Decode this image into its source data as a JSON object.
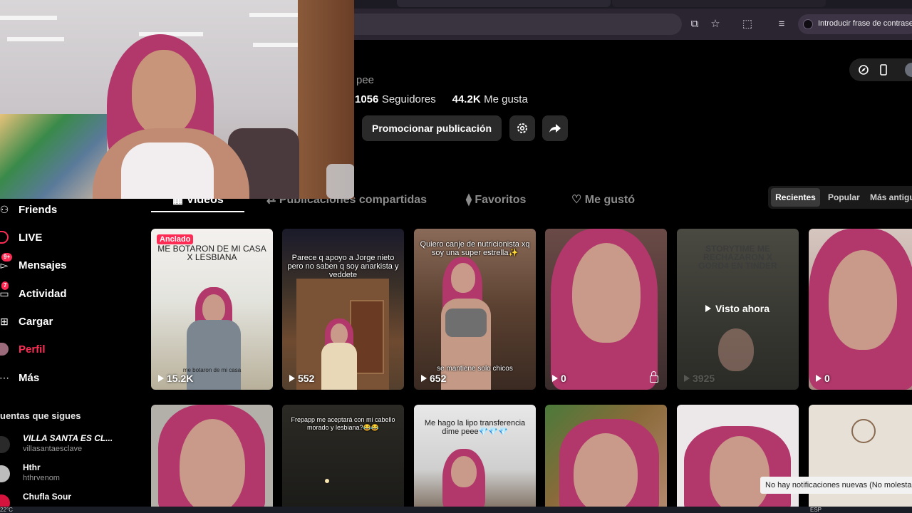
{
  "browser": {
    "extension_prompt": "Introducir frase de contrase"
  },
  "profile": {
    "username_fragment": "pee",
    "followers_count": "1056",
    "followers_label": "Seguidores",
    "likes_count": "44.2K",
    "likes_label": "Me gusta",
    "promote_button": "Promocionar publicación"
  },
  "content_tabs": [
    {
      "label": "Videos",
      "active": true
    },
    {
      "label": "Publicaciones compartidas",
      "active": false
    },
    {
      "label": "Favoritos",
      "active": false
    },
    {
      "label": "Me gustó",
      "active": false
    }
  ],
  "sort_options": [
    "Recientes",
    "Popular",
    "Más antigu"
  ],
  "sidebar": {
    "items": [
      {
        "label": "Friends",
        "icon": "friends-icon"
      },
      {
        "label": "LIVE",
        "icon": "live-icon"
      },
      {
        "label": "Mensajes",
        "icon": "messages-icon",
        "badge": "9+"
      },
      {
        "label": "Actividad",
        "icon": "activity-icon",
        "badge": "7"
      },
      {
        "label": "Cargar",
        "icon": "upload-icon"
      },
      {
        "label": "Perfil",
        "icon": "profile-avatar-icon",
        "active": true
      },
      {
        "label": "Más",
        "icon": "more-icon"
      }
    ],
    "following_heading": "uentas que sigues",
    "following": [
      {
        "name": "VILLA SANTA ES CL...",
        "handle": "villasantaesclave"
      },
      {
        "name": "Hthr",
        "handle": "hthrvenom"
      },
      {
        "name": "Chufla Sour",
        "handle": ""
      }
    ]
  },
  "videos": [
    {
      "caption": "ME BOTARON DE MI CASA X LESBIANA",
      "views": "15.2K",
      "pinned_label": "Anclado",
      "subcaption": "me botaron de mi casa"
    },
    {
      "caption": "Parece q apoyo a Jorge nieto pero no saben q soy anarkista y veddete",
      "views": "552"
    },
    {
      "caption": "Quiero canje de nutricionista xq soy una super estrella✨",
      "views": "652",
      "subcaption": "se mantiene solo chicos"
    },
    {
      "caption": "",
      "views": "0",
      "locked": true
    },
    {
      "caption": "STORYTIME ME RECHAZARON X GORD4 EN TINDER",
      "views": "3925",
      "overlay": "Visto ahora"
    },
    {
      "caption": "",
      "views": "0"
    },
    {
      "caption": "",
      "views": ""
    },
    {
      "caption": "Frepapp me aceptará con mi cabello morado y lesbiana?😂😂",
      "views": ""
    },
    {
      "caption": "Me hago la lipo transferencia dime peee💎💎💎",
      "views": ""
    },
    {
      "caption": "",
      "views": ""
    },
    {
      "caption": "",
      "views": ""
    },
    {
      "caption": "",
      "views": ""
    }
  ],
  "notification": "No hay notificaciones nuevas  (No molesta",
  "taskbar": {
    "weather": "22°C",
    "language": "ESP"
  },
  "colors": {
    "accent": "#fe2c55",
    "hair": "#b2376b"
  }
}
